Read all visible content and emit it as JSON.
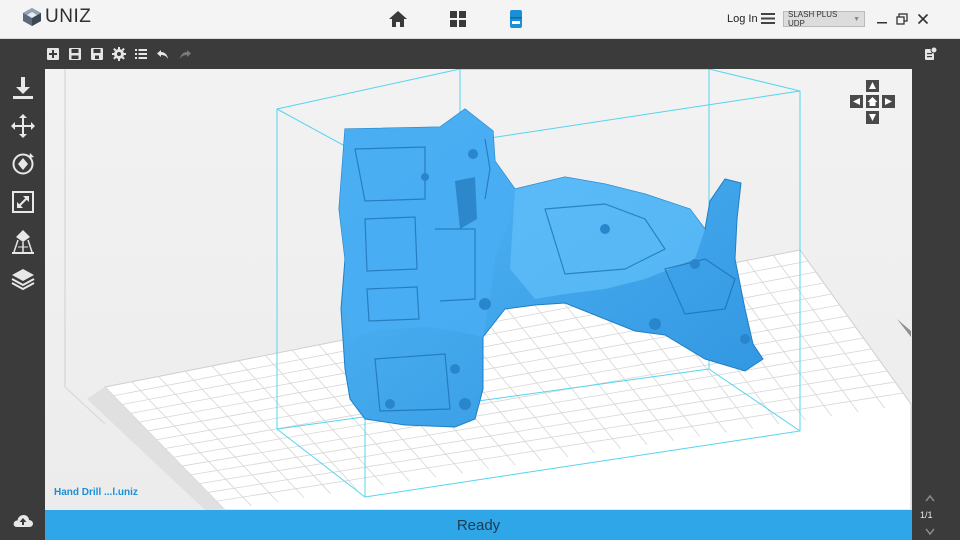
{
  "app": {
    "name": "UNIZ",
    "login_label": "Log In",
    "printer": "SLASH PLUS UDP"
  },
  "nav": {
    "items": [
      "home-icon",
      "apps-grid-icon",
      "printer-icon"
    ],
    "active": "printer-icon",
    "accent": "#1a8fd8"
  },
  "toolbar": {
    "icons": [
      "add-model-icon",
      "save-icon",
      "save-as-icon",
      "settings-icon",
      "list-icon",
      "undo-icon",
      "redo-icon"
    ]
  },
  "sidebar": {
    "icons": [
      "import-icon",
      "move-icon",
      "rotate-icon",
      "scale-icon",
      "support-icon",
      "layers-icon",
      "upload-icon"
    ]
  },
  "viewport": {
    "filename": "Hand Drill ...l.uniz",
    "model_color": "#3fa9f5",
    "bounding_box_color": "#55d4ef"
  },
  "status": {
    "text": "Ready",
    "page": "1/1",
    "bar_color": "#2ea6e8"
  }
}
